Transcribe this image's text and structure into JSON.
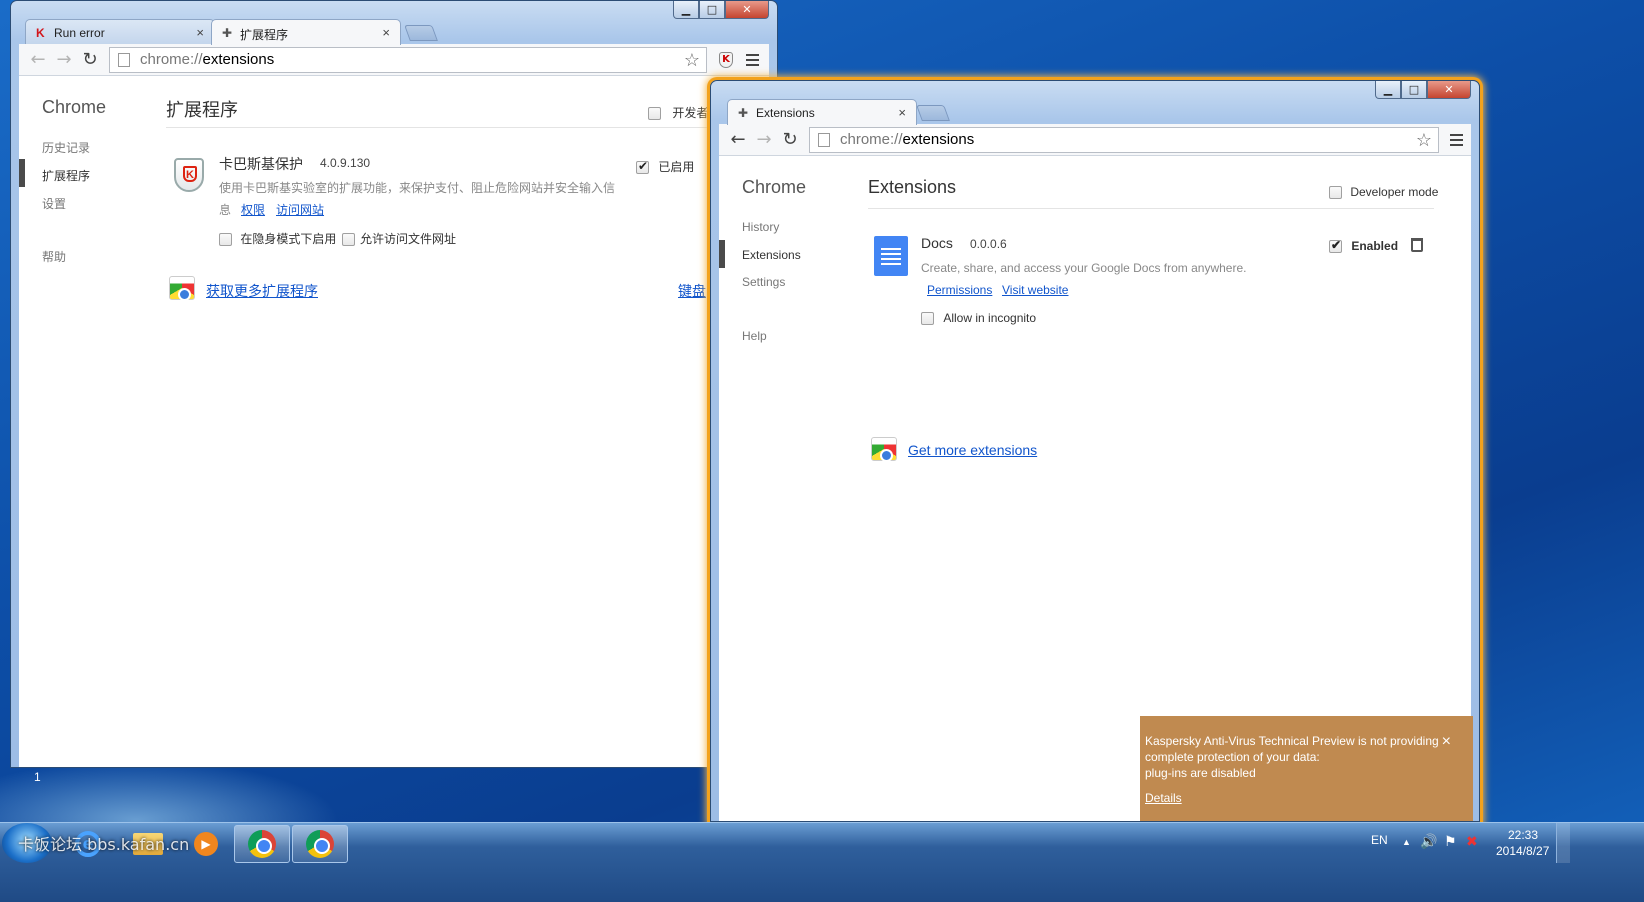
{
  "left_window": {
    "tabs": [
      {
        "label": "Run error",
        "icon": "kaspersky-k-icon"
      },
      {
        "label": "扩展程序",
        "icon": "puzzle-icon"
      }
    ],
    "url_scheme": "chrome://",
    "url_path": "extensions",
    "side_title": "Chrome",
    "side_items": [
      "历史记录",
      "扩展程序",
      "设置",
      "帮助"
    ],
    "heading": "扩展程序",
    "dev_mode_label": "开发者",
    "extension": {
      "name": "卡巴斯基保护",
      "version": "4.0.9.130",
      "enabled_label": "已启用",
      "description": "使用卡巴斯基实验室的扩展功能，来保护支付、阻止危险网站并安全输入信",
      "description_cont": "息",
      "permissions_link": "权限",
      "website_link": "访问网站",
      "incognito_label": "在隐身模式下启用",
      "file_url_label": "允许访问文件网址"
    },
    "get_more_label": "获取更多扩展程序",
    "keyboard_link": "键盘"
  },
  "right_window": {
    "tabs": [
      {
        "label": "Extensions",
        "icon": "puzzle-icon"
      }
    ],
    "url_scheme": "chrome://",
    "url_path": "extensions",
    "side_title": "Chrome",
    "side_items": [
      "History",
      "Extensions",
      "Settings",
      "Help"
    ],
    "heading": "Extensions",
    "dev_mode_label": "Developer mode",
    "extension": {
      "name": "Docs",
      "version": "0.0.0.6",
      "enabled_label": "Enabled",
      "description": "Create, share, and access your Google Docs from anywhere.",
      "permissions_link": "Permissions",
      "website_link": "Visit website",
      "incognito_label": "Allow in incognito"
    },
    "get_more_label": "Get more extensions"
  },
  "toast": {
    "message_line1": "Kaspersky Anti-Virus Technical Preview is not providing",
    "message_line2": "complete protection of your data:",
    "message_line3": "plug-ins are disabled",
    "details_link": "Details",
    "close": "×"
  },
  "taskbar": {
    "language": "EN",
    "time": "22:33",
    "date": "2014/8/27",
    "watermark": "卡饭论坛 bbs.kafan.cn",
    "desktop_number": "1"
  },
  "colors": {
    "active_glow": "#f3a21c",
    "link": "#1155cc",
    "toast_bg": "#c08a50"
  }
}
